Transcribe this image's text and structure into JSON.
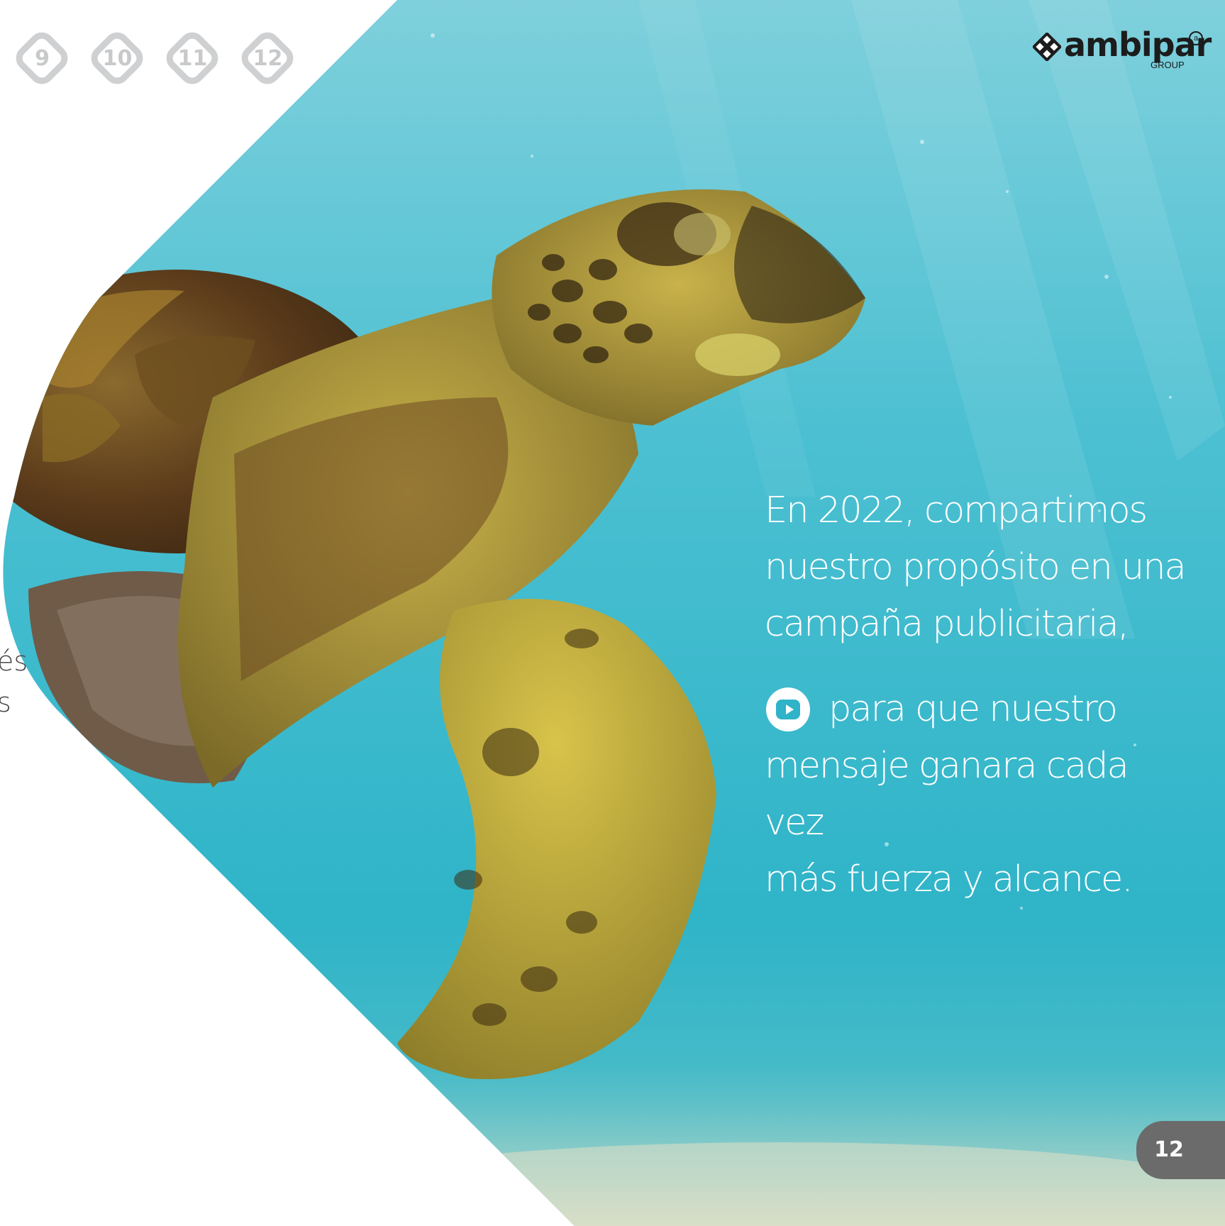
{
  "nav": {
    "pages": [
      {
        "label": "9"
      },
      {
        "label": "10"
      },
      {
        "label": "11"
      },
      {
        "label": "12"
      }
    ]
  },
  "left_page": {
    "fragment_1": "és",
    "fragment_2": "s"
  },
  "logo": {
    "name": "ambipar",
    "sub": "GROUP",
    "reg": "a"
  },
  "main": {
    "paragraph_1": "En 2022, compartimos nuestro propósito en una campaña publicitaria,",
    "line_1": "En 2022, compartimos",
    "line_2": "nuestro propósito en una",
    "line_3": "campaña publicitaria,",
    "line_4": "para que nuestro",
    "line_5": "mensaje ganara cada vez",
    "line_6": "más fuerza y alcance.",
    "video_icon": "youtube-icon"
  },
  "page_number": "12",
  "colors": {
    "water": "#2fb3c9",
    "water_light": "#7fd3df",
    "nav_grey": "#cfd0d1",
    "tab_grey": "#6b6b6b",
    "text": "#ffffff"
  }
}
